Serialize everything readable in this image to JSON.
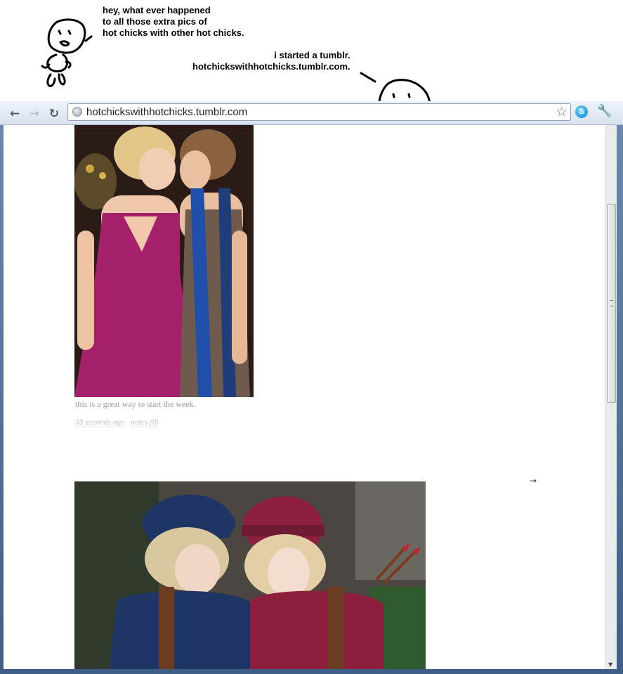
{
  "comic": {
    "caption_top": "hey, what ever happened\nto all those extra pics of\nhot chicks with other hot chicks.",
    "caption_reply": "i started a tumblr.\nhotchickswithhotchicks.tumblr.com."
  },
  "browser": {
    "url": "hotchickswithhotchicks.tumblr.com",
    "skype_label": "S"
  },
  "posts": [
    {
      "caption": "this is a great way to start the week.",
      "time": "33 seconds ago",
      "notes": "notes (0)"
    }
  ],
  "pagination": {
    "next_arrow": "→"
  },
  "colors": {
    "toolbar": "#dbe4ef",
    "caption_text": "#999999",
    "meta_text": "#c4c4c4"
  }
}
